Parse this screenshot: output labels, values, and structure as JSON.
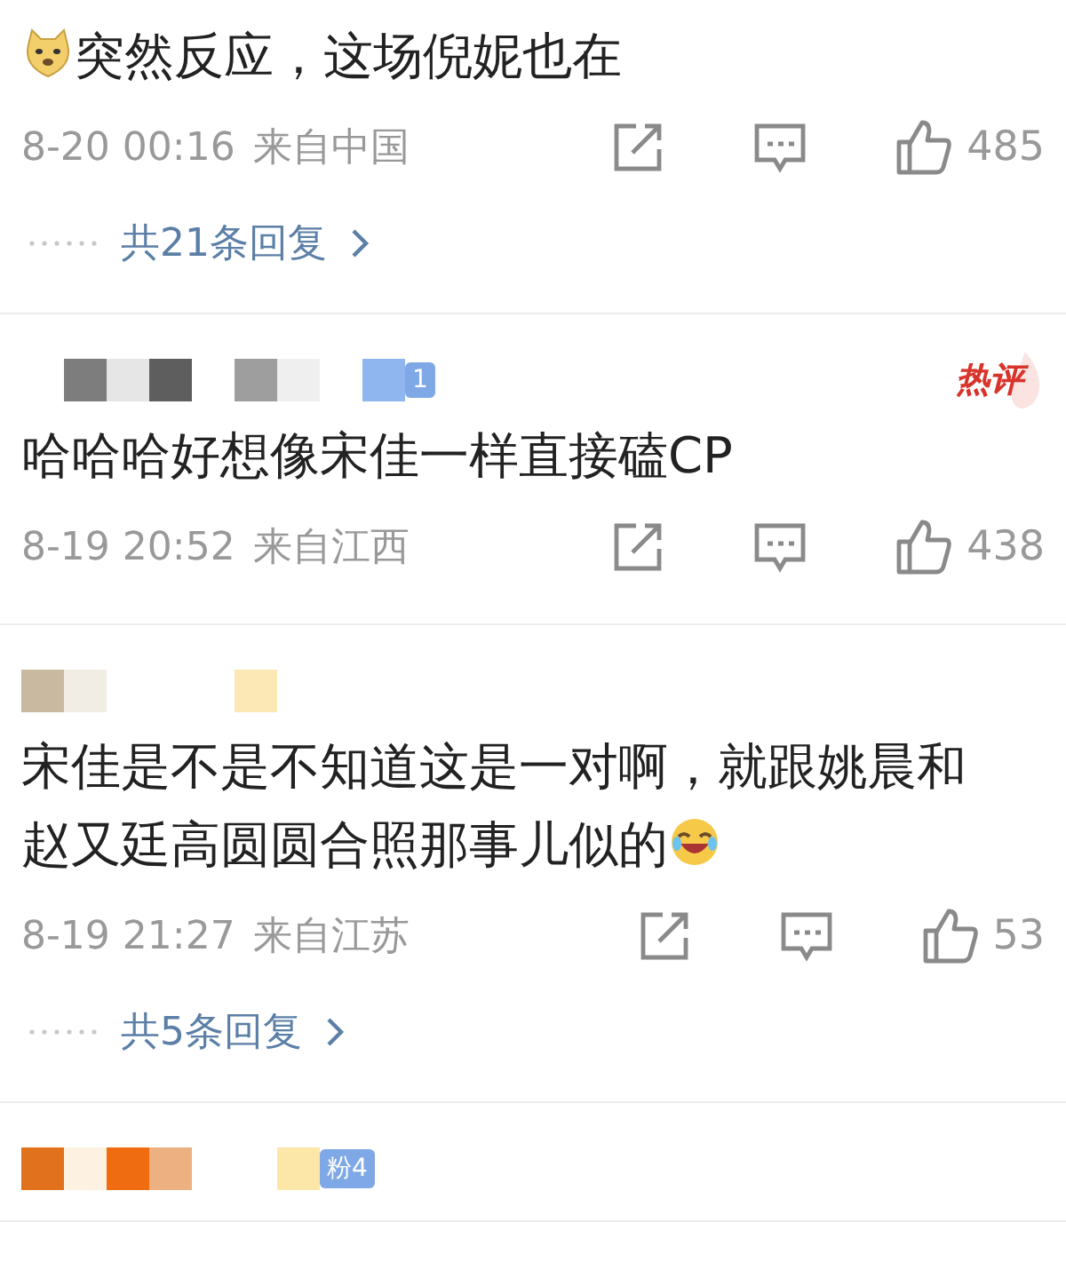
{
  "comments": [
    {
      "hot": false,
      "lead_emoji": {
        "kind": "doge"
      },
      "text": "突然反应，这场倪妮也在",
      "date": "8-20 00:16",
      "location": "来自中国",
      "likes": "485",
      "replies": "共21条回复"
    },
    {
      "author": {
        "kind": "mosaic-grey"
      },
      "hot": true,
      "hot_label": "热评",
      "badge": "1",
      "text": "哈哈哈好想像宋佳一样直接磕CP",
      "date": "8-19 20:52",
      "location": "来自江西",
      "likes": "438"
    },
    {
      "author": {
        "kind": "mosaic-pale"
      },
      "hot": false,
      "text": "宋佳是不是不知道这是一对啊，就跟姚晨和赵又廷高圆圆合照那事儿似的",
      "trail_emoji": {
        "kind": "laugh"
      },
      "date": "8-19 21:27",
      "location": "来自江苏",
      "likes": "53",
      "replies": "共5条回复"
    },
    {
      "author": {
        "kind": "mosaic-orange"
      },
      "hot": false,
      "badge": "粉4"
    }
  ]
}
